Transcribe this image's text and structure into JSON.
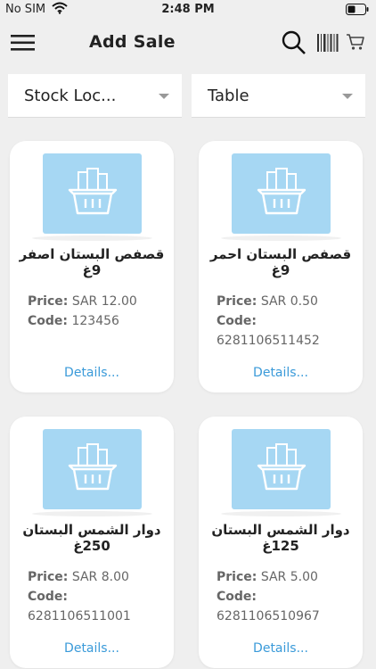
{
  "status": {
    "carrier": "No SIM",
    "time": "2:48 PM"
  },
  "header": {
    "title": "Add Sale"
  },
  "filters": {
    "location": "Stock Loc...",
    "view": "Table"
  },
  "labels": {
    "price": "Price:",
    "code": "Code:",
    "details": "Details..."
  },
  "products": [
    {
      "name": "قصفص البستان اصفر 9غ",
      "price": "SAR 12.00",
      "code": "123456"
    },
    {
      "name": "قصفص البستان احمر 9غ",
      "price": "SAR 0.50",
      "code": "6281106511452"
    },
    {
      "name": "دوار الشمس البستان 250غ",
      "price": "SAR 8.00",
      "code": "6281106511001"
    },
    {
      "name": "دوار الشمس البستان 125غ",
      "price": "SAR 5.00",
      "code": "6281106510967"
    }
  ],
  "colors": {
    "accent": "#3a9ad9",
    "thumb": "#a6d7f3",
    "background": "#efefef"
  },
  "icons": [
    "wifi-icon",
    "battery-icon",
    "menu-icon",
    "search-icon",
    "barcode-icon",
    "cart-icon",
    "basket-icon",
    "dropdown-caret-icon"
  ]
}
